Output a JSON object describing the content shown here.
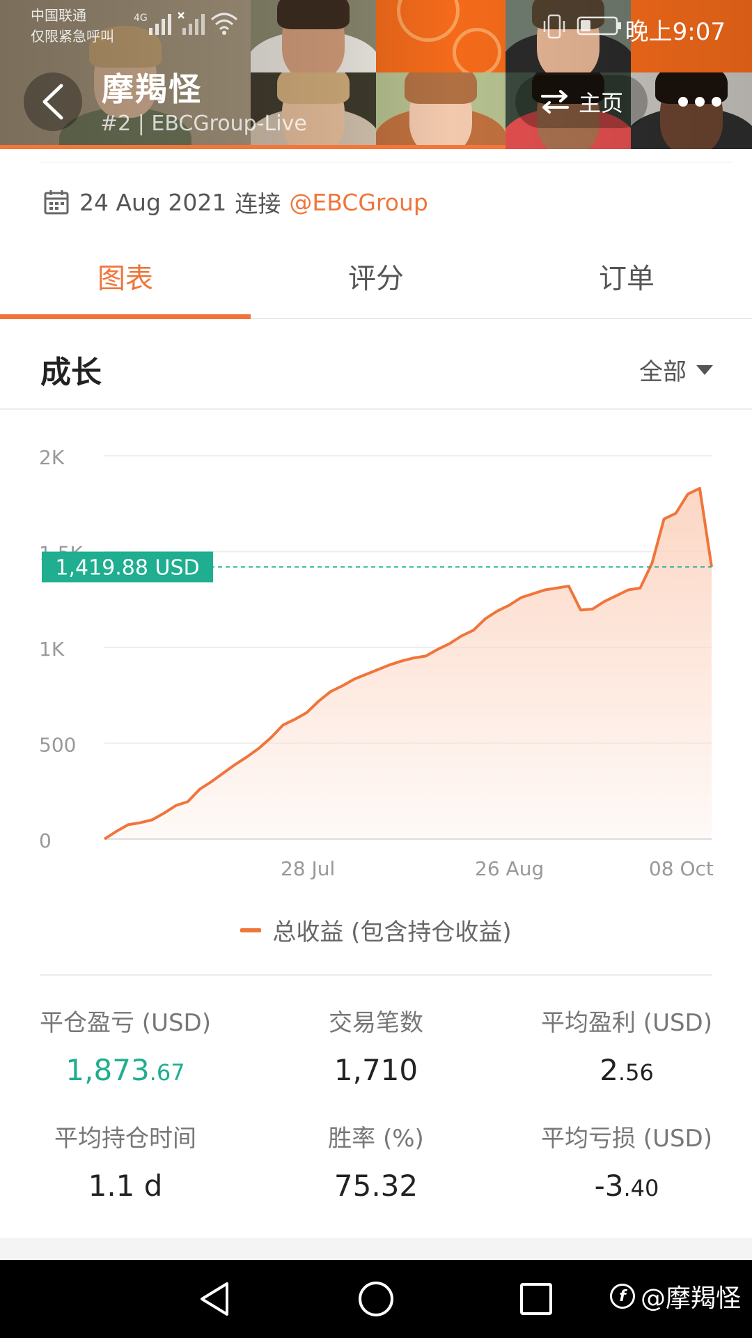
{
  "status_bar": {
    "carrier": "中国联通",
    "carrier_note": "仅限紧急呼叫",
    "network": "4G",
    "time": "晚上9:07"
  },
  "header": {
    "title": "摩羯怪",
    "subtitle": "#2 | EBCGroup-Live",
    "home_label": "主页"
  },
  "info": {
    "date": "24 Aug 2021",
    "connect_word": "连接",
    "broker": "@EBCGroup"
  },
  "tabs": [
    {
      "label": "图表",
      "active": true
    },
    {
      "label": "评分",
      "active": false
    },
    {
      "label": "订单",
      "active": false
    }
  ],
  "growth": {
    "title": "成长",
    "range": "全部"
  },
  "chart_data": {
    "type": "area",
    "series_name": "总收益 (包含持仓收益)",
    "y_ticks": [
      "0",
      "500",
      "1K",
      "1.5K",
      "2K"
    ],
    "ylim": [
      0,
      2000
    ],
    "x_ticks": [
      "28 Jul",
      "26 Aug",
      "08 Oct"
    ],
    "current_value_label": "1,419.88 USD",
    "current_value": 1419.88,
    "values": [
      0,
      40,
      75,
      85,
      100,
      135,
      175,
      195,
      260,
      300,
      345,
      390,
      430,
      475,
      530,
      595,
      625,
      660,
      720,
      770,
      800,
      835,
      860,
      885,
      910,
      930,
      945,
      955,
      990,
      1020,
      1060,
      1090,
      1150,
      1190,
      1220,
      1260,
      1280,
      1300,
      1310,
      1320,
      1195,
      1200,
      1240,
      1270,
      1300,
      1310,
      1440,
      1670,
      1700,
      1800,
      1830,
      1419.88
    ],
    "line_color": "#f0753a",
    "fill_color": "#fcd4c1",
    "marker_color": "#1fae8f",
    "grid": true
  },
  "stats": [
    {
      "label": "平仓盈亏 (USD)",
      "int": "1,873",
      "dec": ".67",
      "green": true
    },
    {
      "label": "交易笔数",
      "int": "1,710",
      "dec": "",
      "green": false
    },
    {
      "label": "平均盈利 (USD)",
      "int": "2",
      "dec": ".56",
      "green": false
    },
    {
      "label": "平均持仓时间",
      "int": "1.1 d",
      "dec": "",
      "green": false
    },
    {
      "label": "胜率 (%)",
      "int": "75.32",
      "dec": "",
      "green": false
    },
    {
      "label": "平均亏损 (USD)",
      "int": "-3",
      "dec": ".40",
      "green": false
    }
  ],
  "watermark": "@摩羯怪",
  "colors": {
    "accent": "#f0753a",
    "positive": "#1fae8f"
  }
}
